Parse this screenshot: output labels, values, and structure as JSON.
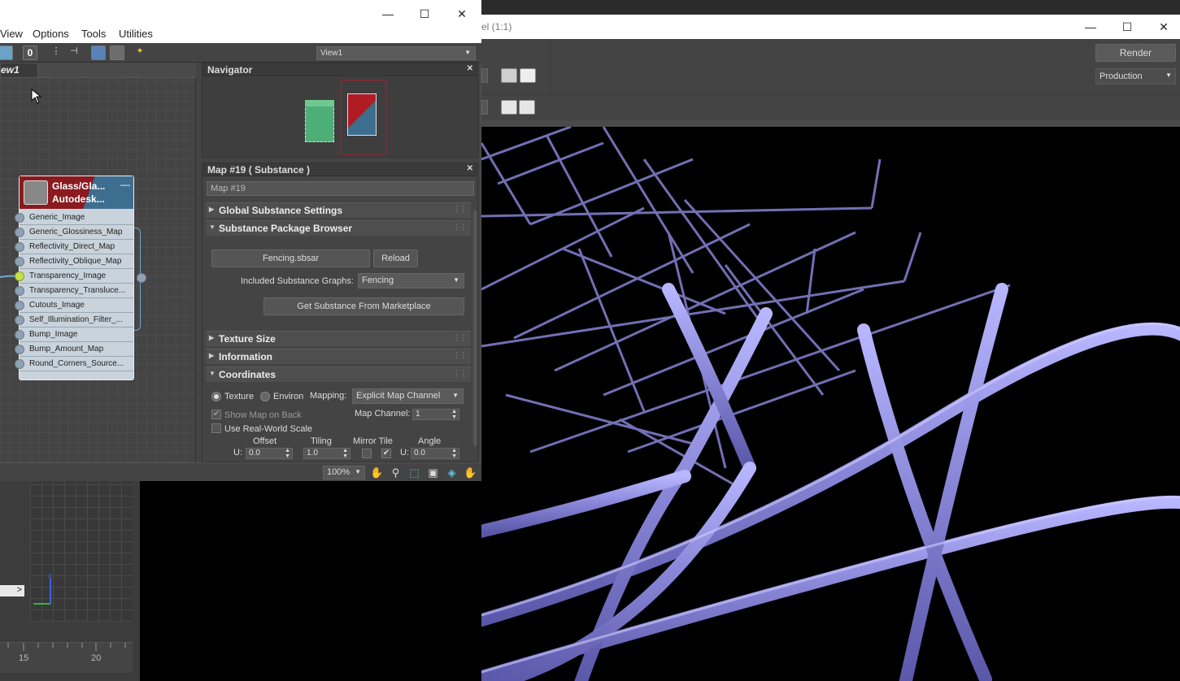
{
  "render_window": {
    "title_partial": "el (1:1)",
    "render_button": "Render",
    "production_select": "Production"
  },
  "slate": {
    "menu": [
      "View",
      "Options",
      "Tools",
      "Utilities"
    ],
    "view_select": "View1",
    "view_tab": "ew1",
    "node": {
      "title_line1": "Glass/Gla...",
      "title_line2": "Autodesk...",
      "slots": [
        "Generic_Image",
        "Generic_Glossiness_Map",
        "Reflectivity_Direct_Map",
        "Reflectivity_Oblique_Map",
        "Transparency_Image",
        "Transparency_Transluce...",
        "Cutouts_Image",
        "Self_Illumination_Filter_...",
        "Bump_Image",
        "Bump_Amount_Map",
        "Round_Corners_Source..."
      ]
    },
    "navigator": {
      "title": "Navigator"
    },
    "params": {
      "title": "Map #19  ( Substance )",
      "map_name": "Map #19",
      "rollouts": {
        "global": "Global Substance Settings",
        "package": "Substance Package Browser",
        "texture_size": "Texture Size",
        "information": "Information",
        "coordinates": "Coordinates"
      },
      "package_button": "Fencing.sbsar",
      "reload_button": "Reload",
      "graphs_label": "Included Substance Graphs:",
      "graphs_value": "Fencing",
      "marketplace_button": "Get Substance From Marketplace",
      "texture_label": "Texture",
      "environ_label": "Environ",
      "mapping_label": "Mapping:",
      "mapping_value": "Explicit Map Channel",
      "show_map_label": "Show Map on Back",
      "map_channel_label": "Map Channel:",
      "map_channel_value": "1",
      "real_world_label": "Use Real-World Scale",
      "offset_label": "Offset",
      "tiling_label": "Tiling",
      "mirror_tile_label": "Mirror Tile",
      "angle_label": "Angle",
      "u_label": "U:",
      "offset_u": "0.0",
      "tiling_u": "1.0",
      "angle_u": "0.0",
      "mirror_check": "✔"
    },
    "zoom": "100%"
  },
  "timeline": {
    "ticks": [
      "15",
      "20"
    ]
  },
  "colors": {
    "node_socket_active": "#c4e34a",
    "fence_wire": "#8b88d8",
    "navigator_green": "#4caf78",
    "navigator_red": "#b01c24"
  }
}
